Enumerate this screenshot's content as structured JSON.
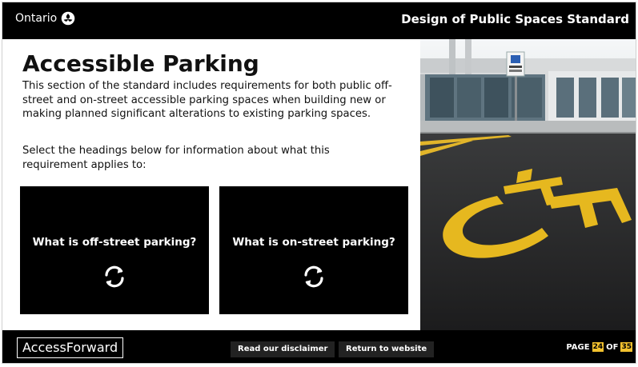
{
  "header": {
    "logo_text": "Ontario",
    "course_title": "Design of Public Spaces Standard"
  },
  "main": {
    "title": "Accessible Parking",
    "intro": "This section of the standard includes requirements for both public off-street and on-street accessible parking spaces when building new or making planned significant alterations to existing parking spaces.",
    "prompt": "Select the headings below for information about what this requirement applies to:",
    "cards": [
      {
        "label": "What is off-street parking?",
        "icon": "flip-icon"
      },
      {
        "label": "What is on-street parking?",
        "icon": "flip-icon"
      }
    ]
  },
  "footer": {
    "brand": "AccessForward",
    "disclaimer_label": "Read our disclaimer",
    "return_label": "Return to website",
    "page_prefix": "PAGE",
    "page_current": "24",
    "page_of": "OF",
    "page_total": "35"
  },
  "colors": {
    "bar_background": "#000000",
    "accent_yellow": "#f2c12e"
  }
}
